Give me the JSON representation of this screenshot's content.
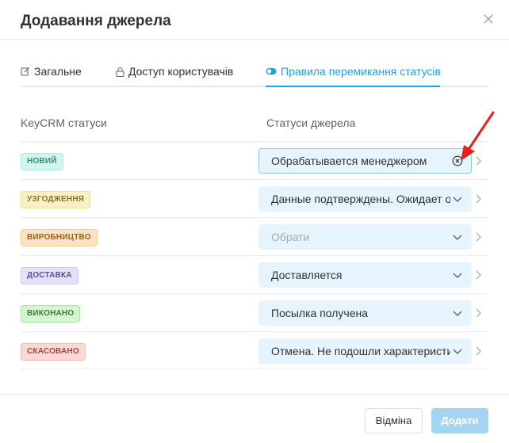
{
  "dialog": {
    "title": "Додавання джерела"
  },
  "tabs": [
    {
      "label": "Загальне",
      "icon": "edit-icon",
      "active": false
    },
    {
      "label": "Доступ користувачів",
      "icon": "lock-icon",
      "active": false
    },
    {
      "label": "Правила перемикання статусів",
      "icon": "toggle-icon",
      "active": true
    }
  ],
  "columns": {
    "left": "KeyCRM статуси",
    "right": "Статуси джерела"
  },
  "rows": [
    {
      "status": "НОВИЙ",
      "badge_bg": "#d2f5ef",
      "badge_border": "#a6eadd",
      "badge_color": "#3d8a7c",
      "value": "Обрабатывается менеджером",
      "placeholder": false,
      "suffix": "clear-icon"
    },
    {
      "status": "УЗГОДЖЕННЯ",
      "badge_bg": "#faf0c6",
      "badge_border": "#f2e08d",
      "badge_color": "#8c7626",
      "value": "Данные подтверждены. Ожидает отп",
      "placeholder": false,
      "suffix": "chevron-down-icon"
    },
    {
      "status": "ВИРОБНИЦТВО",
      "badge_bg": "#fde3c4",
      "badge_border": "#f9c98d",
      "badge_color": "#9b5f1e",
      "value": "Обрати",
      "placeholder": true,
      "suffix": "chevron-down-icon"
    },
    {
      "status": "ДОСТАВКА",
      "badge_bg": "#e6e1f9",
      "badge_border": "#cfc6f1",
      "badge_color": "#5c4d9e",
      "value": "Доставляется",
      "placeholder": false,
      "suffix": "chevron-down-icon"
    },
    {
      "status": "ВИКОНАНО",
      "badge_bg": "#d3f5cf",
      "badge_border": "#a7e79f",
      "badge_color": "#3d7d35",
      "value": "Посылка получена",
      "placeholder": false,
      "suffix": "chevron-down-icon"
    },
    {
      "status": "СКАСОВАНО",
      "badge_bg": "#fdd9d6",
      "badge_border": "#f9b3ad",
      "badge_color": "#a8443b",
      "value": "Отмена. Не подошли характеристик",
      "placeholder": false,
      "suffix": "chevron-down-icon"
    }
  ],
  "footer": {
    "cancel_label": "Відміна",
    "submit_label": "Додати"
  },
  "colors": {
    "accent": "#1ea1e2",
    "annotation": "#e8201c"
  }
}
